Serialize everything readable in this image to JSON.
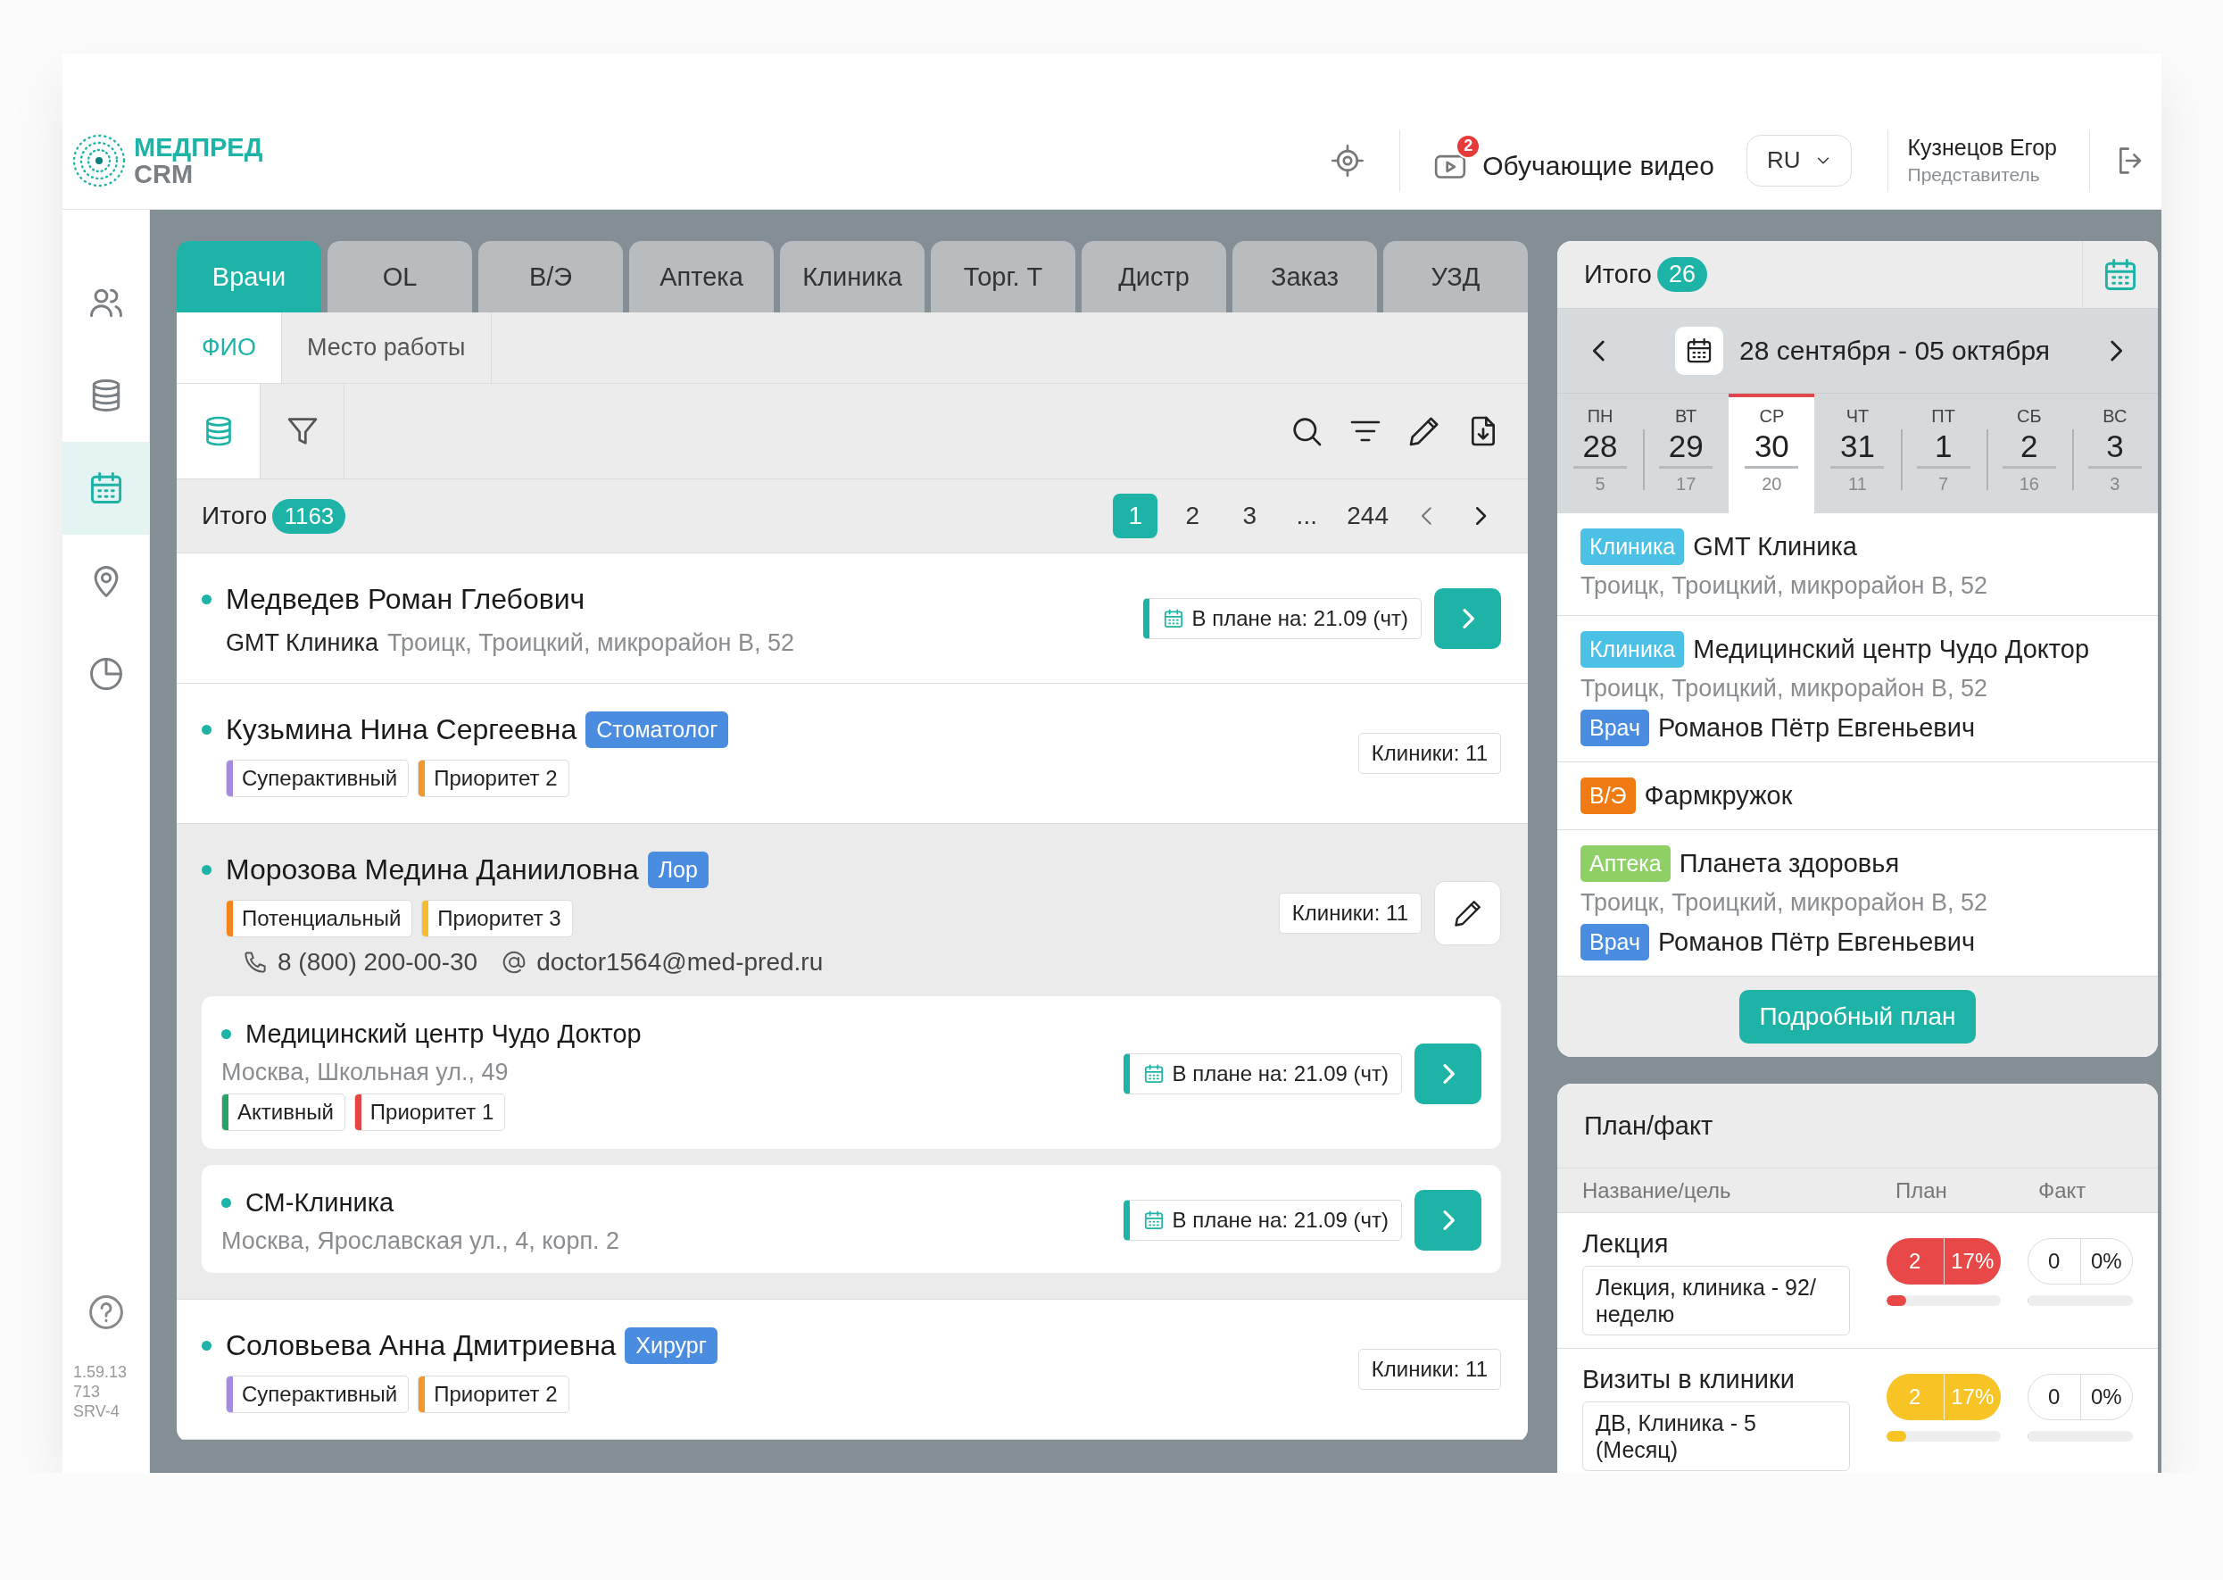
{
  "header": {
    "logo": [
      "МЕДПРЕД",
      "CRM"
    ],
    "video": {
      "badge": "2",
      "label": "Обучающие видео"
    },
    "language": "RU",
    "user": {
      "name": "Кузнецов Егор",
      "role": "Представитель"
    }
  },
  "sidebar": {
    "items": [
      {
        "selected": false
      },
      {
        "selected": false
      },
      {
        "selected": true
      },
      {
        "selected": false
      },
      {
        "selected": false
      }
    ],
    "version": [
      "1.59.13",
      "713",
      "SRV-4"
    ]
  },
  "tabs": [
    {
      "label": "Врачи",
      "selected": true
    },
    {
      "label": "OL",
      "selected": false
    },
    {
      "label": "В/Э",
      "selected": false
    },
    {
      "label": "Аптека",
      "selected": false
    },
    {
      "label": "Клиника",
      "selected": false
    },
    {
      "label": "Торг. Т",
      "selected": false
    },
    {
      "label": "Дистр",
      "selected": false
    },
    {
      "label": "Заказ",
      "selected": false
    },
    {
      "label": "УЗД",
      "selected": false
    }
  ],
  "subtabs": [
    {
      "label": "ФИО",
      "selected": true
    },
    {
      "label": "Место работы",
      "selected": false
    }
  ],
  "views": [
    {
      "selected": true
    },
    {
      "selected": false
    }
  ],
  "total": {
    "label": "Итого",
    "count": "1163"
  },
  "pagination": [
    {
      "label": "1",
      "selected": true
    },
    {
      "label": "2",
      "selected": false
    },
    {
      "label": "3",
      "selected": false
    },
    {
      "label": "...",
      "selected": false
    },
    {
      "label": "244",
      "selected": false
    }
  ],
  "doctors": [
    {
      "name": "Медведев Роман Глебович",
      "expanded": false,
      "place": "GMT Клиника",
      "address": "Троицк, Троицкий, микрорайон В, 52",
      "plan": "В плане на: 21.09 (чт)"
    },
    {
      "name": "Кузьмина Нина Сергеевна",
      "specialty": "Стоматолог",
      "expanded": false,
      "tags": [
        {
          "label": "Суперактивный",
          "color": "#a58be0"
        },
        {
          "label": "Приоритет 2",
          "color": "#f5962a"
        }
      ],
      "clinics": "Клиники: 11"
    },
    {
      "name": "Морозова Медина Данииловна",
      "specialty": "Лор",
      "expanded": true,
      "tags": [
        {
          "label": "Потенциальный",
          "color": "#f5841f"
        },
        {
          "label": "Приоритет 3",
          "color": "#f5bd2e"
        }
      ],
      "clinics": "Клиники: 11",
      "phone": "8 (800) 200-00-30",
      "email": "doctor1564@med-pred.ru",
      "children": [
        {
          "name": "Медицинский центр Чудо Доктор",
          "address": "Москва, Школьная ул., 49",
          "tags": [
            {
              "label": "Активный",
              "color": "#27a36a"
            },
            {
              "label": "Приоритет 1",
              "color": "#e64545"
            }
          ],
          "plan": "В плане на: 21.09 (чт)"
        },
        {
          "name": "СМ-Клиника",
          "address": "Москва, Ярославская ул., 4, корп. 2",
          "plan": "В плане на: 21.09 (чт)"
        }
      ]
    },
    {
      "name": "Соловьева Анна Дмитриевна",
      "specialty": "Хирург",
      "expanded": false,
      "tags": [
        {
          "label": "Суперактивный",
          "color": "#a58be0"
        },
        {
          "label": "Приоритет 2",
          "color": "#f5962a"
        }
      ],
      "clinics": "Клиники: 11"
    }
  ],
  "schedule": {
    "total": {
      "label": "Итого",
      "count": "26"
    },
    "range": "28 сентября - 05 октября",
    "days": [
      {
        "dow": "ПН",
        "date": "28",
        "count": "5",
        "selected": false
      },
      {
        "dow": "ВТ",
        "date": "29",
        "count": "17",
        "selected": false
      },
      {
        "dow": "СР",
        "date": "30",
        "count": "20",
        "selected": true
      },
      {
        "dow": "ЧТ",
        "date": "31",
        "count": "11",
        "selected": false
      },
      {
        "dow": "ПТ",
        "date": "1",
        "count": "7",
        "selected": false
      },
      {
        "dow": "СБ",
        "date": "2",
        "count": "16",
        "selected": false
      },
      {
        "dow": "ВС",
        "date": "3",
        "count": "3",
        "selected": false
      }
    ],
    "events": [
      {
        "type": "Клиника",
        "color": "#4cc1e6",
        "name": "GMT Клиника",
        "address": "Троицк, Троицкий, микрорайон В, 52"
      },
      {
        "type": "Клиника",
        "color": "#4cc1e6",
        "name": "Медицинский центр Чудо Доктор",
        "address": "Троицк, Троицкий, микрорайон В, 52",
        "person": {
          "type": "Врач",
          "color": "#4a8de0",
          "name": "Романов Пётр Евгеньевич"
        }
      },
      {
        "type": "В/Э",
        "color": "#f07b12",
        "name": "Фармкружок"
      },
      {
        "type": "Аптека",
        "color": "#8fd066",
        "name": "Планета здоровья",
        "address": "Троицк, Троицкий, микрорайон В, 52",
        "person": {
          "type": "Врач",
          "color": "#4a8de0",
          "name": "Романов Пётр Евгеньевич"
        }
      }
    ],
    "button": "Подробный план"
  },
  "plan_fact": {
    "title": "План/факт",
    "columns": [
      "Название/цель",
      "План",
      "Факт"
    ],
    "rows": [
      {
        "name": "Лекция",
        "goal": "Лекция, клиника - 92/неделю",
        "plan": {
          "count": "2",
          "percent": "17%",
          "level": 0.17,
          "color": "#e84848"
        },
        "fact": {
          "count": "0",
          "percent": "0%",
          "level": 0
        }
      },
      {
        "name": "Визиты в клиники",
        "goal": "ДВ, Клиника - 5 (Месяц)",
        "plan": {
          "count": "2",
          "percent": "17%",
          "level": 0.17,
          "color": "#f7c325"
        },
        "fact": {
          "count": "0",
          "percent": "0%",
          "level": 0
        }
      }
    ]
  }
}
